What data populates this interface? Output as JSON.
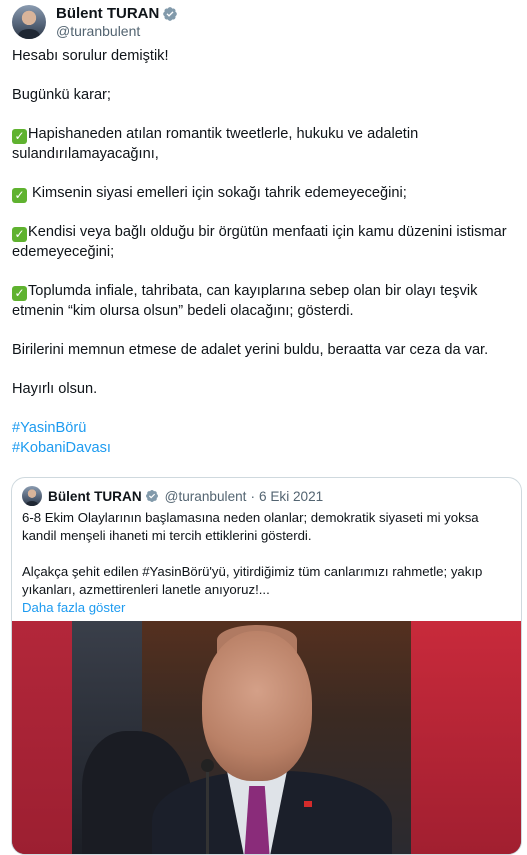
{
  "author": {
    "display_name": "Bülent TURAN",
    "handle": "@turanbulent",
    "verified_icon": "verified-badge-icon"
  },
  "tweet": {
    "lines": [
      "Hesabı sorulur demiştik!",
      "Bugünkü karar;",
      "Hapishaneden atılan romantik tweetlerle, hukuku ve adaletin sulandırılamayacağını,",
      " Kimsenin siyasi emelleri için sokağı tahrik edemeyeceğini;",
      "Kendisi veya bağlı olduğu bir örgütün menfaati için kamu düzenini istismar edemeyeceğini;",
      "Toplumda infiale, tahribata, can kayıplarına sebep olan bir olayı teşvik etmenin “kim olursa olsun” bedeli olacağını; gösterdi.",
      "Birilerini memnun etmese de adalet yerini buldu, beraatta var ceza da var.",
      "Hayırlı olsun."
    ],
    "check_glyph": "✓",
    "hashtags": [
      "#YasinBörü",
      "#KobaniDavası"
    ]
  },
  "quote": {
    "display_name": "Bülent TURAN",
    "handle": "@turanbulent",
    "separator": "·",
    "date": "6 Eki 2021",
    "text_1": "6-8 Ekim Olaylarının başlamasına neden olanlar; demokratik siyaseti mi yoksa kandil menşeli ihaneti mi tercih ettiklerini gösterdi.",
    "text_2": "Alçakça şehit edilen #YasinBörü'yü, yitirdiğimiz tüm canlarımızı rahmetle; yakıp yıkanları, azmettirenleri lanetle anıyoruz!...",
    "show_more": "Daha fazla göster"
  },
  "colors": {
    "link": "#1d9bf0",
    "verified": "#829aab",
    "check": "#5fb22f"
  }
}
